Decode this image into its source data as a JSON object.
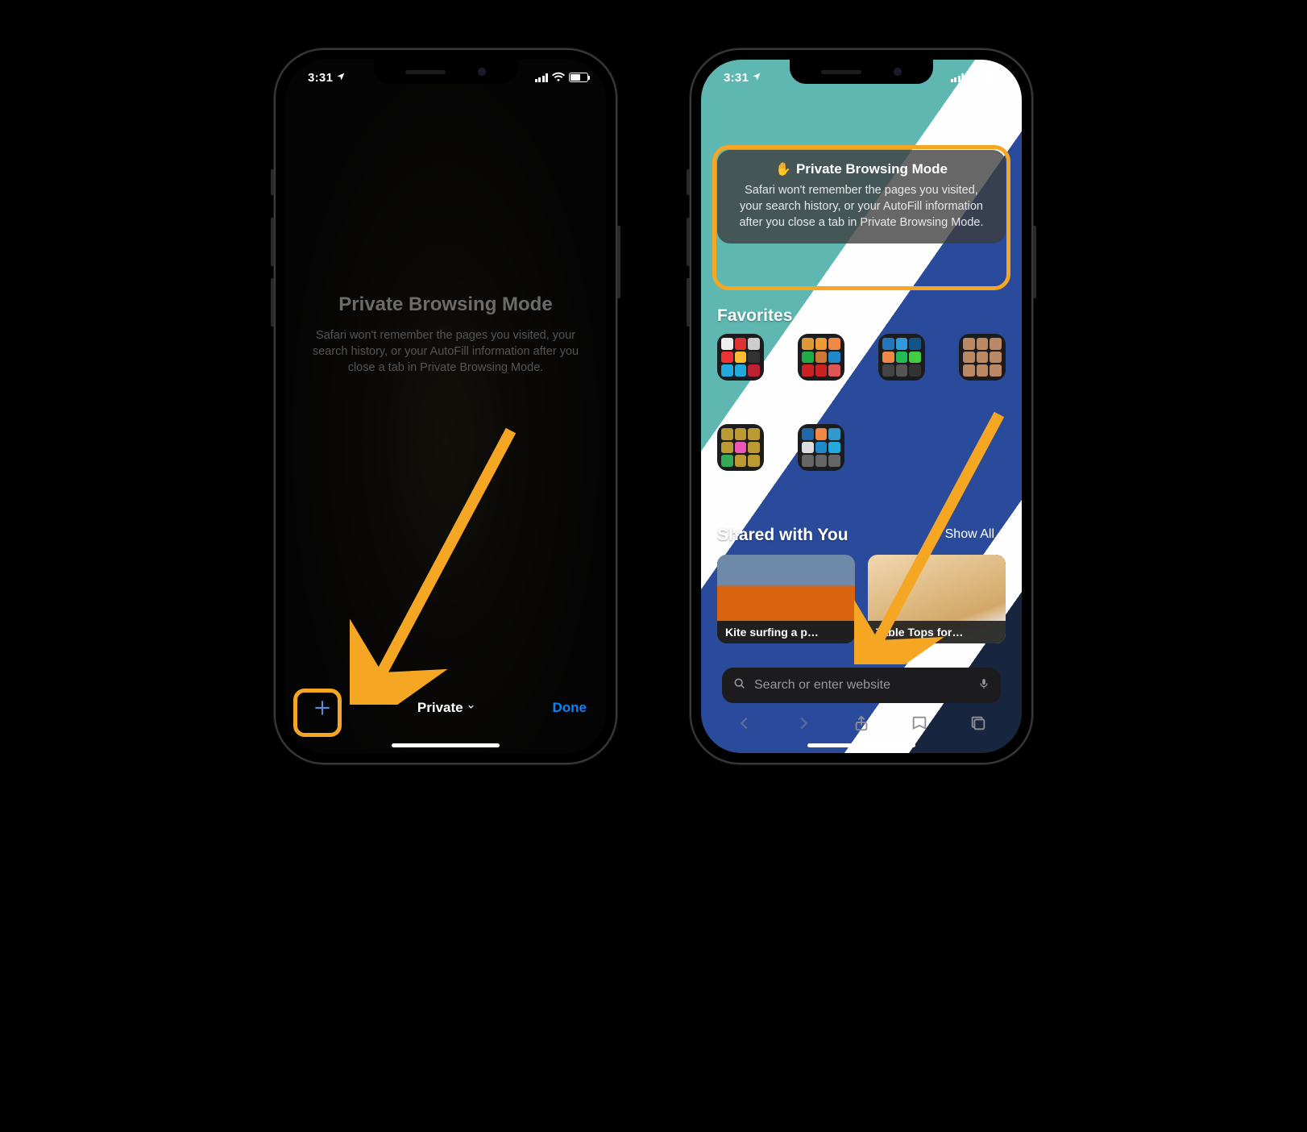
{
  "status": {
    "time": "3:31"
  },
  "phone1": {
    "pbm_title": "Private Browsing Mode",
    "pbm_desc": "Safari won't remember the pages you visited, your search history, or your AutoFill information after you close a tab in Private Browsing Mode.",
    "mode_label": "Private",
    "done_label": "Done"
  },
  "phone2": {
    "notice_title": "Private Browsing Mode",
    "notice_desc": "Safari won't remember the pages you visited, your search history, or your AutoFill information after you close a tab in Private Browsing Mode.",
    "favorites_heading": "Favorites",
    "shared_heading": "Shared with You",
    "show_all": "Show All",
    "shared_items": [
      {
        "caption": "Kite surfing a p…"
      },
      {
        "caption": "Table Tops for…"
      }
    ],
    "search_placeholder": "Search or enter website"
  },
  "colors": {
    "accent_orange": "#f5a623",
    "ios_blue": "#0a84ff"
  }
}
